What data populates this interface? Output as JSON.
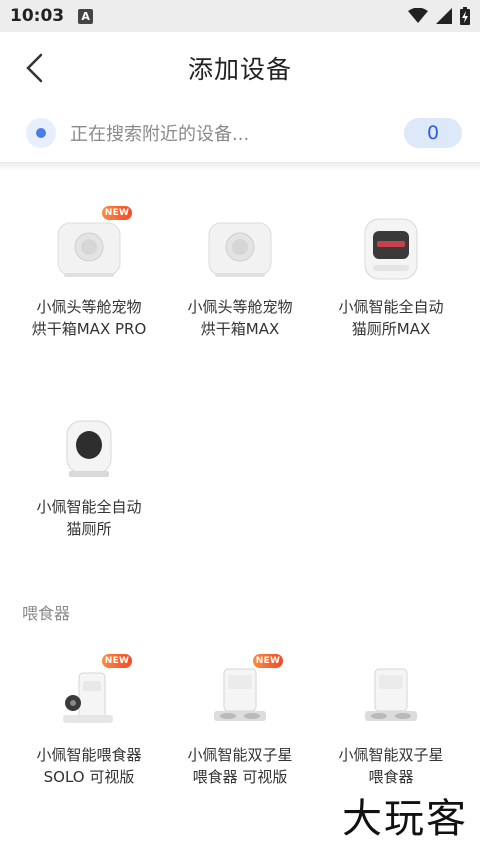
{
  "status_bar": {
    "time": "10:03",
    "app_badge": "A"
  },
  "header": {
    "title": "添加设备"
  },
  "search": {
    "text": "正在搜索附近的设备...",
    "count": "0"
  },
  "sections": [
    {
      "title": "",
      "items": [
        {
          "name": "小佩头等舱宠物烘干箱MAX PRO",
          "is_new": true,
          "device": "dryer"
        },
        {
          "name": "小佩头等舱宠物烘干箱MAX",
          "is_new": false,
          "device": "dryer"
        },
        {
          "name": "小佩智能全自动猫厕所MAX",
          "is_new": false,
          "device": "litter-max"
        },
        {
          "name": "小佩智能全自动猫厕所",
          "is_new": false,
          "device": "litter"
        }
      ]
    },
    {
      "title": "喂食器",
      "items": [
        {
          "name": "小佩智能喂食器 SOLO 可视版",
          "is_new": true,
          "device": "feeder-solo"
        },
        {
          "name": "小佩智能双子星喂食器 可视版",
          "is_new": true,
          "device": "feeder-twin"
        },
        {
          "name": "小佩智能双子星喂食器",
          "is_new": false,
          "device": "feeder-twin"
        }
      ]
    }
  ],
  "badge_text": "NEW",
  "watermark": "大玩客"
}
